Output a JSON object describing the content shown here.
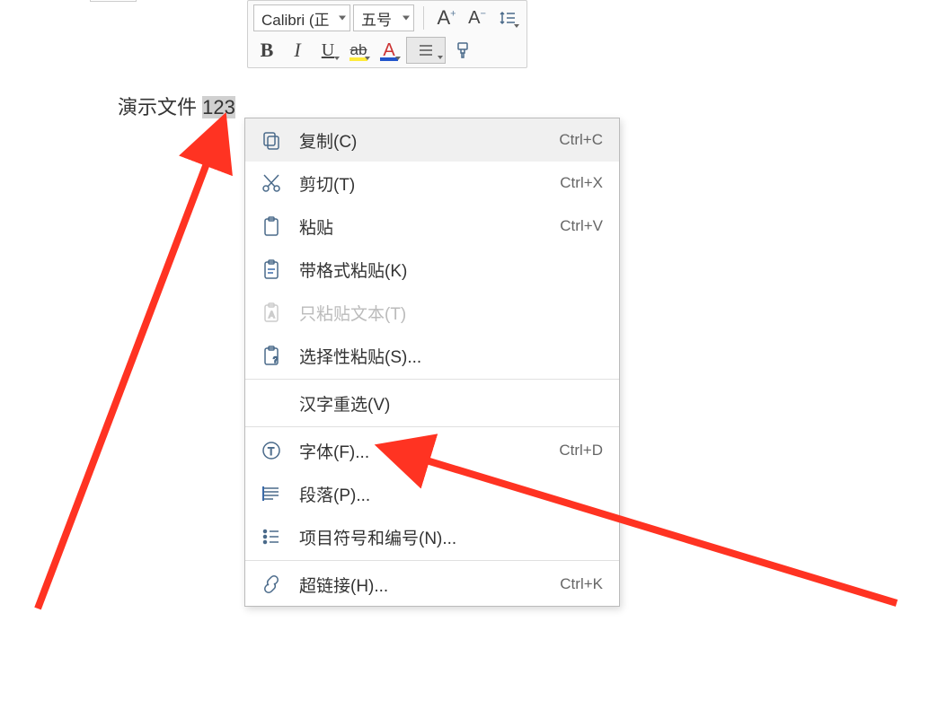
{
  "toolbar": {
    "font_name": "Calibri (正",
    "font_size": "五号",
    "buttons": {
      "grow_font": "A⁺",
      "shrink_font": "A⁻",
      "bold": "B",
      "italic": "I",
      "underline": "U",
      "highlight": "ab",
      "font_color": "A"
    }
  },
  "document": {
    "text_before": "演示文件 ",
    "selected_text": "123"
  },
  "context_menu": {
    "items": [
      {
        "label": "复制(C)",
        "shortcut": "Ctrl+C",
        "icon": "copy",
        "hover": true
      },
      {
        "label": "剪切(T)",
        "shortcut": "Ctrl+X",
        "icon": "cut"
      },
      {
        "label": "粘贴",
        "shortcut": "Ctrl+V",
        "icon": "paste"
      },
      {
        "label": "带格式粘贴(K)",
        "shortcut": "",
        "icon": "paste-format"
      },
      {
        "label": "只粘贴文本(T)",
        "shortcut": "",
        "icon": "paste-text",
        "disabled": true
      },
      {
        "label": "选择性粘贴(S)...",
        "shortcut": "",
        "icon": "paste-special"
      },
      {
        "label": "汉字重选(V)",
        "shortcut": "",
        "icon": ""
      },
      {
        "label": "字体(F)...",
        "shortcut": "Ctrl+D",
        "icon": "font"
      },
      {
        "label": "段落(P)...",
        "shortcut": "",
        "icon": "paragraph"
      },
      {
        "label": "项目符号和编号(N)...",
        "shortcut": "",
        "icon": "list"
      },
      {
        "label": "超链接(H)...",
        "shortcut": "Ctrl+K",
        "icon": "link"
      }
    ],
    "dividers_after": [
      5,
      6,
      9
    ]
  }
}
